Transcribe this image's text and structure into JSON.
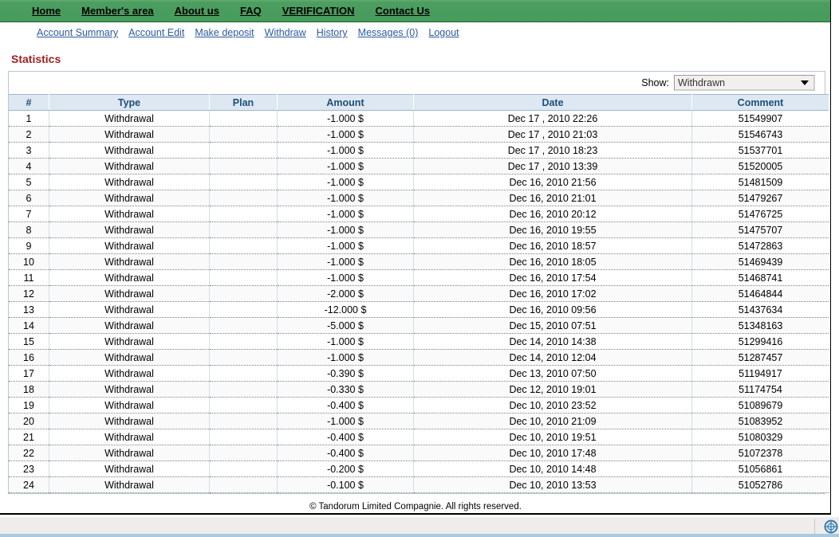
{
  "topnav": {
    "items": [
      {
        "label": "Home"
      },
      {
        "label": "Member's area"
      },
      {
        "label": "About us"
      },
      {
        "label": "FAQ"
      },
      {
        "label": "VERIFICATION"
      },
      {
        "label": "Contact Us"
      }
    ]
  },
  "subnav": {
    "items": [
      {
        "label": "Account Summary"
      },
      {
        "label": "Account Edit"
      },
      {
        "label": "Make deposit"
      },
      {
        "label": "Withdraw"
      },
      {
        "label": "History"
      },
      {
        "label": "Messages (0)"
      },
      {
        "label": "Logout"
      }
    ]
  },
  "page": {
    "title": "Statistics"
  },
  "filter": {
    "label": "Show:",
    "value": "Withdrawn",
    "options": [
      "Withdrawn"
    ]
  },
  "table": {
    "headers": [
      "#",
      "Type",
      "Plan",
      "Amount",
      "Date",
      "Comment"
    ],
    "rows": [
      {
        "num": "1",
        "type": "Withdrawal",
        "plan": "",
        "amount": "-1.000 $",
        "date": "Dec 17 , 2010 22:26",
        "comment": "51549907"
      },
      {
        "num": "2",
        "type": "Withdrawal",
        "plan": "",
        "amount": "-1.000 $",
        "date": "Dec 17 , 2010 21:03",
        "comment": "51546743"
      },
      {
        "num": "3",
        "type": "Withdrawal",
        "plan": "",
        "amount": "-1.000 $",
        "date": "Dec 17 , 2010 18:23",
        "comment": "51537701"
      },
      {
        "num": "4",
        "type": "Withdrawal",
        "plan": "",
        "amount": "-1.000 $",
        "date": "Dec 17 , 2010 13:39",
        "comment": "51520005"
      },
      {
        "num": "5",
        "type": "Withdrawal",
        "plan": "",
        "amount": "-1.000 $",
        "date": "Dec 16, 2010 21:56",
        "comment": "51481509"
      },
      {
        "num": "6",
        "type": "Withdrawal",
        "plan": "",
        "amount": "-1.000 $",
        "date": "Dec 16, 2010 21:01",
        "comment": "51479267"
      },
      {
        "num": "7",
        "type": "Withdrawal",
        "plan": "",
        "amount": "-1.000 $",
        "date": "Dec 16, 2010 20:12",
        "comment": "51476725"
      },
      {
        "num": "8",
        "type": "Withdrawal",
        "plan": "",
        "amount": "-1.000 $",
        "date": "Dec 16, 2010 19:55",
        "comment": "51475707"
      },
      {
        "num": "9",
        "type": "Withdrawal",
        "plan": "",
        "amount": "-1.000 $",
        "date": "Dec 16, 2010 18:57",
        "comment": "51472863"
      },
      {
        "num": "10",
        "type": "Withdrawal",
        "plan": "",
        "amount": "-1.000 $",
        "date": "Dec 16, 2010 18:05",
        "comment": "51469439"
      },
      {
        "num": "11",
        "type": "Withdrawal",
        "plan": "",
        "amount": "-1.000 $",
        "date": "Dec 16, 2010 17:54",
        "comment": "51468741"
      },
      {
        "num": "12",
        "type": "Withdrawal",
        "plan": "",
        "amount": "-2.000 $",
        "date": "Dec 16, 2010 17:02",
        "comment": "51464844"
      },
      {
        "num": "13",
        "type": "Withdrawal",
        "plan": "",
        "amount": "-12.000 $",
        "date": "Dec 16, 2010 09:56",
        "comment": "51437634"
      },
      {
        "num": "14",
        "type": "Withdrawal",
        "plan": "",
        "amount": "-5.000 $",
        "date": "Dec 15, 2010 07:51",
        "comment": "51348163"
      },
      {
        "num": "15",
        "type": "Withdrawal",
        "plan": "",
        "amount": "-1.000 $",
        "date": "Dec 14, 2010 14:38",
        "comment": "51299416"
      },
      {
        "num": "16",
        "type": "Withdrawal",
        "plan": "",
        "amount": "-1.000 $",
        "date": "Dec 14, 2010 12:04",
        "comment": "51287457"
      },
      {
        "num": "17",
        "type": "Withdrawal",
        "plan": "",
        "amount": "-0.390 $",
        "date": "Dec 13, 2010 07:50",
        "comment": "51194917"
      },
      {
        "num": "18",
        "type": "Withdrawal",
        "plan": "",
        "amount": "-0.330 $",
        "date": "Dec 12, 2010 19:01",
        "comment": "51174754"
      },
      {
        "num": "19",
        "type": "Withdrawal",
        "plan": "",
        "amount": "-0.400 $",
        "date": "Dec 10, 2010 23:52",
        "comment": "51089679"
      },
      {
        "num": "20",
        "type": "Withdrawal",
        "plan": "",
        "amount": "-1.000 $",
        "date": "Dec 10, 2010 21:09",
        "comment": "51083952"
      },
      {
        "num": "21",
        "type": "Withdrawal",
        "plan": "",
        "amount": "-0.400 $",
        "date": "Dec 10, 2010 19:51",
        "comment": "51080329"
      },
      {
        "num": "22",
        "type": "Withdrawal",
        "plan": "",
        "amount": "-0.400 $",
        "date": "Dec 10, 2010 17:48",
        "comment": "51072378"
      },
      {
        "num": "23",
        "type": "Withdrawal",
        "plan": "",
        "amount": "-0.200 $",
        "date": "Dec 10, 2010 14:48",
        "comment": "51056861"
      },
      {
        "num": "24",
        "type": "Withdrawal",
        "plan": "",
        "amount": "-0.100 $",
        "date": "Dec 10, 2010 13:53",
        "comment": "51052786"
      }
    ]
  },
  "footer": {
    "copyright": "© Tandorum Limited Compagnie. All rights reserved."
  },
  "colors": {
    "nav_green": "#479b5c",
    "link_blue": "#2b5b9e",
    "title_red": "#9c2020",
    "header_blue_bg": "#dde8f2",
    "header_blue_text": "#1f4e79"
  }
}
